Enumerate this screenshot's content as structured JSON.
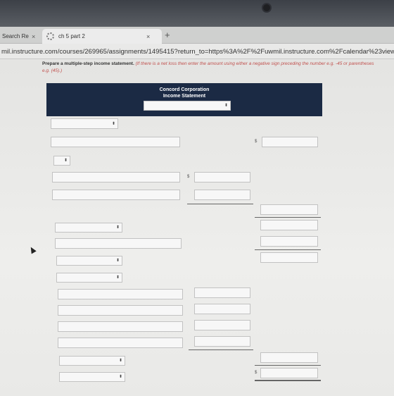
{
  "browser": {
    "tabs": [
      {
        "label": "Search Re",
        "active": false
      },
      {
        "label": "ch 5 part 2",
        "active": true
      }
    ],
    "close_glyph": "×",
    "new_tab_glyph": "+",
    "url": "mil.instructure.com/courses/269965/assignments/1495415?return_to=https%3A%2F%2Fuwmil.instructure.com%2Fcalendar%23view_"
  },
  "assignment": {
    "instruction_bold": "Prepare a multiple-step income statement.",
    "instruction_hint": " (If there is a net loss then enter the amount using either a negative sign preceding the number e.g. -45 or parentheses e.g. (45).)"
  },
  "statement": {
    "company": "Concord Corporation",
    "title": "Income Statement",
    "dollar_sign": "$",
    "select_arrow": "⬍"
  }
}
